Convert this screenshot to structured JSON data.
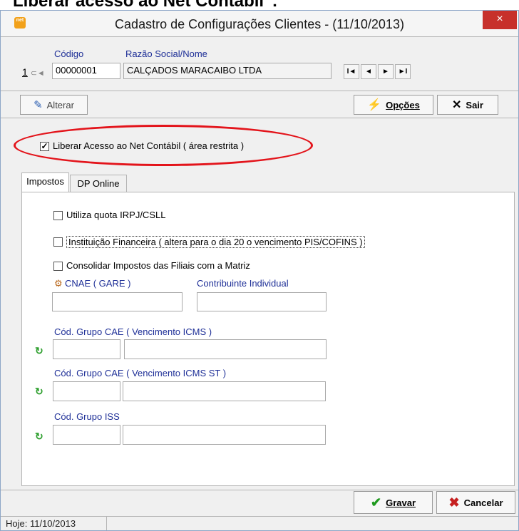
{
  "caption": "Liberar acesso ao Net Contábil\":",
  "window": {
    "title": "Cadastro de Configurações Clientes - (11/10/2013)",
    "app_icon_text": "net",
    "close_glyph": "×"
  },
  "header": {
    "codigo_label": "Código",
    "razao_label": "Razão Social/Nome",
    "record_number": "1",
    "codigo_value": "00000001",
    "razao_value": "CALÇADOS MARACAIBO LTDA",
    "nav": [
      "first-record-icon",
      "previous-record-icon",
      "next-record-icon",
      "last-record-icon"
    ]
  },
  "toolbar": {
    "alterar_label": "Alterar",
    "opcoes_label": "Opções",
    "sair_label": "Sair"
  },
  "liberar": {
    "label": "Liberar Acesso ao Net Contábil ( área restrita )",
    "checked": true,
    "highlight_color": "#e3141b"
  },
  "tabs": [
    {
      "label": "Impostos",
      "active": true
    },
    {
      "label": "DP Online",
      "active": false
    }
  ],
  "impostos": {
    "checks": [
      {
        "label": "Utiliza quota IRPJ/CSLL",
        "checked": false
      },
      {
        "label": "Instituição Financeira ( altera para o dia 20 o vencimento PIS/COFINS )",
        "checked": false
      },
      {
        "label": "Consolidar Impostos das Filiais com a Matriz",
        "checked": false
      }
    ],
    "cnae_label": "CNAE ( GARE )",
    "contribuinte_label": "Contribuinte Individual",
    "cnae_value": "",
    "contribuinte_value": "",
    "grupo_icms_label": "Cód. Grupo CAE ( Vencimento ICMS )",
    "grupo_icms_st_label": "Cód. Grupo CAE ( Vencimento ICMS ST )",
    "grupo_iss_label": "Cód. Grupo ISS",
    "grupo_icms_code": "",
    "grupo_icms_desc": "",
    "grupo_icms_st_code": "",
    "grupo_icms_st_desc": "",
    "grupo_iss_code": "",
    "grupo_iss_desc": ""
  },
  "footer": {
    "gravar_label": "Gravar",
    "cancelar_label": "Cancelar",
    "status": "Hoje: 11/10/2013"
  },
  "colors": {
    "label_blue": "#1e2f97",
    "close_red": "#c7302b",
    "confirm_green": "#1f9a1f",
    "cancel_red": "#c62020"
  }
}
